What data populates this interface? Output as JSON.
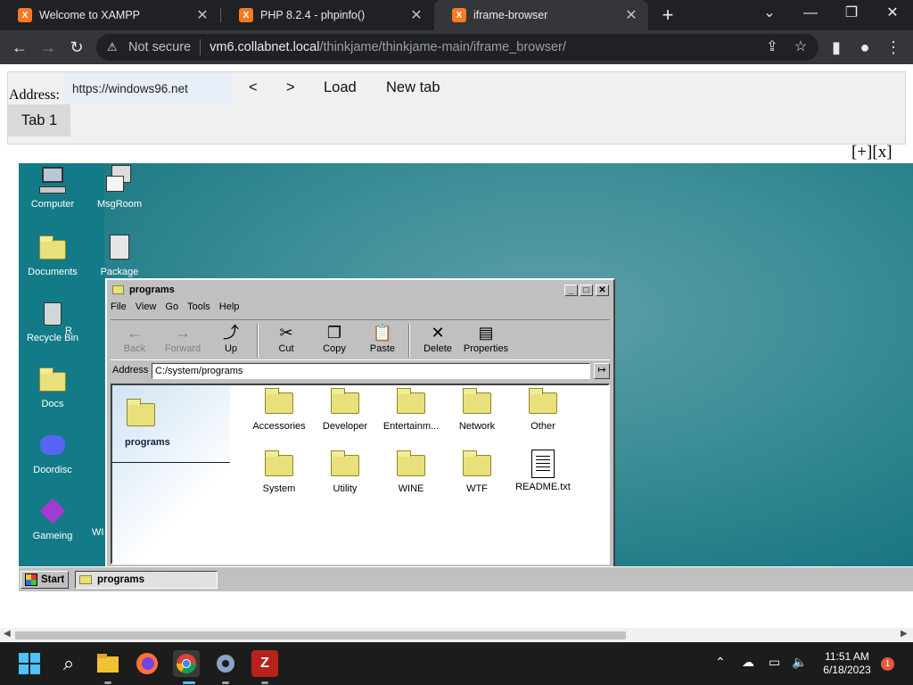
{
  "browser": {
    "tabs": [
      {
        "title": "Welcome to XAMPP",
        "favicon": "xampp-icon"
      },
      {
        "title": "PHP 8.2.4 - phpinfo()",
        "favicon": "xampp-icon"
      },
      {
        "title": "iframe-browser",
        "favicon": "xampp-icon"
      }
    ],
    "omnibox": {
      "security_label": "Not secure",
      "host": "vm6.collabnet.local",
      "path": "/thinkjame/thinkjame-main/iframe_browser/"
    }
  },
  "iframe_browser": {
    "address_label": "Address:",
    "address_value": "https://windows96.net",
    "back_label": "<",
    "forward_label": ">",
    "load_label": "Load",
    "new_tab_label": "New tab",
    "tab_label": "Tab 1",
    "plus_close_label": "[+][x]"
  },
  "w96": {
    "desktop_icons": [
      {
        "label": "Computer"
      },
      {
        "label": "MsgRoom"
      },
      {
        "label": "Documents"
      },
      {
        "label": "Package"
      },
      {
        "label": "Recycle Bin"
      },
      {
        "label": "R"
      },
      {
        "label": "Docs"
      },
      {
        "label": "Doordisc"
      },
      {
        "label": "Gameing"
      },
      {
        "label": "WI"
      }
    ],
    "window": {
      "title": "programs",
      "menu": [
        "File",
        "View",
        "Go",
        "Tools",
        "Help"
      ],
      "toolbar": [
        "Back",
        "Forward",
        "Up",
        "Cut",
        "Copy",
        "Paste",
        "Delete",
        "Properties"
      ],
      "address_label": "Address",
      "address_value": "C:/system/programs",
      "side_title": "programs",
      "items": [
        "Accessories",
        "Developer",
        "Entertainm...",
        "Network",
        "Other",
        "System",
        "Utility",
        "WINE",
        "WTF",
        "README.txt"
      ]
    },
    "taskbar": {
      "start_label": "Start",
      "task_label": "programs"
    }
  },
  "os_taskbar": {
    "time": "11:51 AM",
    "date": "6/18/2023",
    "notification_count": "1"
  }
}
